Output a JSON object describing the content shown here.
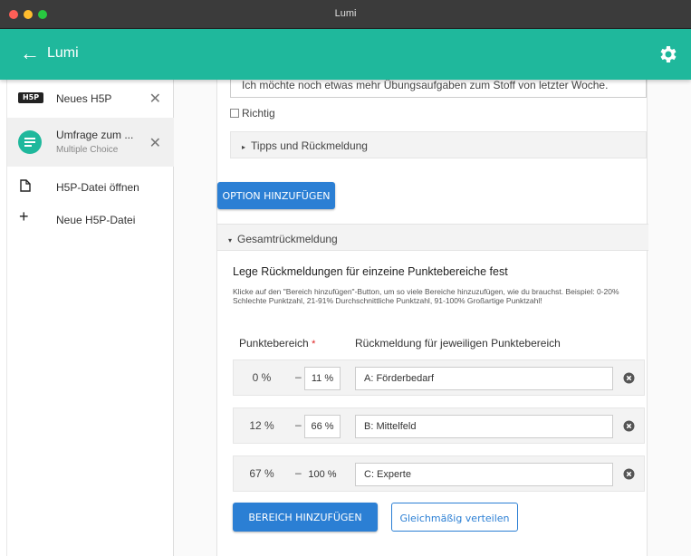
{
  "window": {
    "title": "Lumi"
  },
  "app": {
    "title": "Lumi",
    "back_icon": "arrow-left-icon",
    "settings_icon": "gear-icon"
  },
  "sidebar": {
    "items": [
      {
        "label": "Neues H5P",
        "badge": "H5P",
        "icon": "h5p-logo-icon",
        "closable": true
      },
      {
        "label": "Umfrage zum ...",
        "sublabel": "Multiple Choice",
        "icon": "multiple-choice-icon",
        "closable": true,
        "active": true
      },
      {
        "label": "H5P-Datei öffnen",
        "icon": "file-icon"
      },
      {
        "label": "Neue H5P-Datei",
        "icon": "plus-icon"
      }
    ],
    "close_glyph": "✕"
  },
  "editor": {
    "answer_text": "Ich möchte noch etwas mehr Übungsaufgaben zum Stoff von letzter Woche.",
    "correct_label": "Richtig",
    "tips_label": "Tipps und Rückmeldung",
    "add_option_label": "OPTION HINZUFÜGEN",
    "overall_feedback_label": "Gesamtrückmeldung",
    "feedback_heading": "Lege Rückmeldungen für einzeine Punktebereiche fest",
    "feedback_desc": "Klicke auf den \"Bereich hinzufügen\"-Button, um so viele Bereiche hinzuzufügen, wie du brauchst. Beispiel: 0-20% Schlechte Punktzahl, 21-91% Durchschnittliche Punktzahl, 91-100% Großartige Punktzahl!",
    "col_range": "Punktebereich",
    "col_range_required": "*",
    "col_feedback": "Rückmeldung für jeweiligen Punktebereich",
    "ranges": [
      {
        "from": "0 %",
        "dash": "–",
        "to": "11 %",
        "feedback": "A: Förderbedarf"
      },
      {
        "from": "12 %",
        "dash": "–",
        "to": "66 %",
        "feedback": "B: Mittelfeld"
      },
      {
        "from": "67 %",
        "dash": "–",
        "to": "100 %",
        "feedback": "C: Experte"
      }
    ],
    "add_range_label": "BEREICH HINZUFÜGEN",
    "distribute_label": "Gleichmäßig verteilen"
  },
  "colors": {
    "accent": "#1fb89c",
    "button_blue": "#2b7fd4",
    "titlebar": "#3b3b3b"
  }
}
